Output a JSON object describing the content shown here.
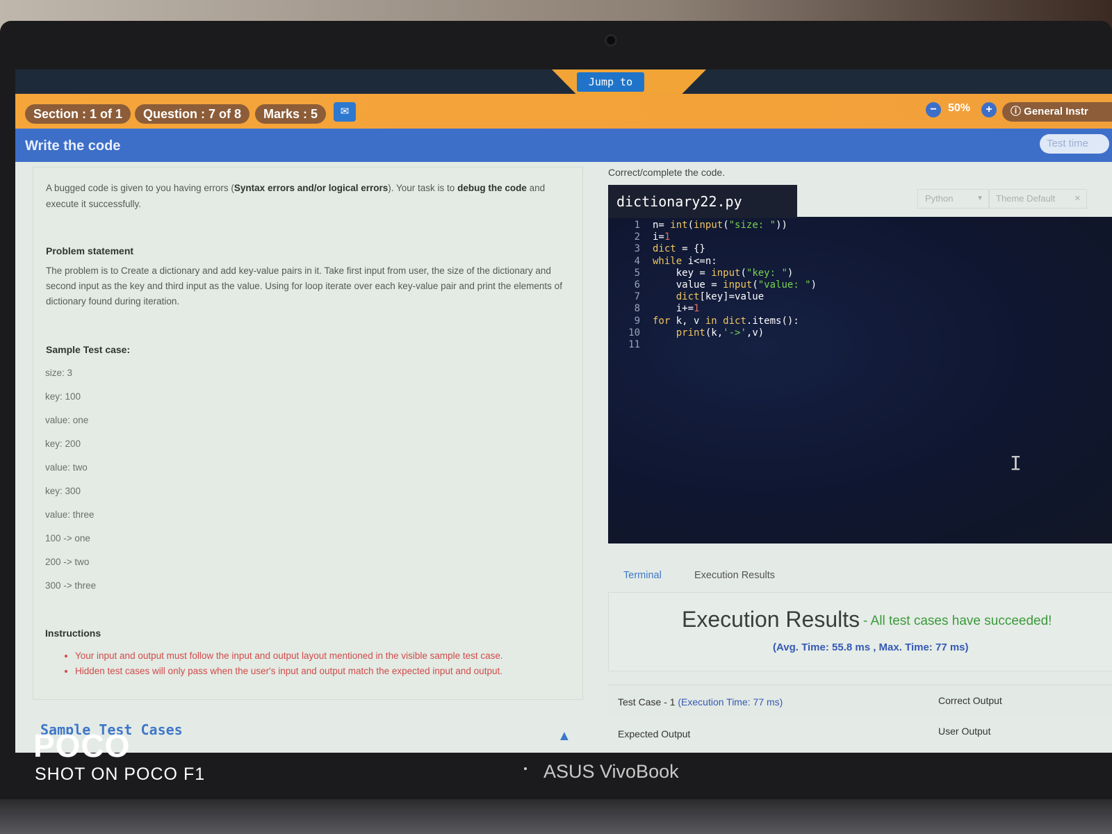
{
  "header": {
    "jump_to": "Jump to",
    "section": "Section : 1 of 1",
    "question": "Question : 7 of 8",
    "marks": "Marks : 5",
    "zoom_level": "50%",
    "general_instructions": "General Instr",
    "page_title": "Write the code",
    "test_timer": "Test time"
  },
  "problem": {
    "intro_part1": "A bugged code is given to you having errors (",
    "intro_bold1": "Syntax errors and/or logical errors",
    "intro_part2": "). Your task is to ",
    "intro_bold2": "debug the code",
    "intro_part3": " and execute it successfully.",
    "statement_heading": "Problem statement",
    "statement_text": "The problem is to Create a dictionary and add key-value pairs in it. Take first input from user, the size of the dictionary and second input as the key and third input as the value. Using for loop iterate over each key-value pair and print the elements of dictionary found during iteration.",
    "sample_heading": "Sample Test case:",
    "sample_lines": [
      "size: 3",
      "key: 100",
      "value: one",
      "key: 200",
      "value: two",
      "key: 300",
      "value: three",
      "100 -> one",
      "200 -> two",
      "300 -> three"
    ],
    "instructions_heading": "Instructions",
    "instructions": [
      "Your input and output must follow the input and output layout mentioned in the visible sample test case.",
      "Hidden test cases will only pass when the user's input and output match the expected input and output."
    ],
    "sample_test_cases_link": "Sample Test Cases"
  },
  "editor": {
    "heading": "Correct/complete the code.",
    "filename": "dictionary22.py",
    "language": "Python",
    "theme": "Theme Default",
    "code_lines": [
      "n= int(input(\"size: \"))",
      "i=1",
      "dict = {}",
      "while i<=n:",
      "    key = input(\"key: \")",
      "    value = input(\"value: \")",
      "    dict[key]=value",
      "    i+=1",
      "for k, v in dict.items():",
      "    print(k,'->',v)",
      ""
    ]
  },
  "results": {
    "tab_terminal": "Terminal",
    "tab_execution": "Execution Results",
    "title": "Execution Results",
    "message": "- All test cases have succeeded!",
    "times": "(Avg. Time: 55.8 ms , Max. Time: 77 ms)",
    "case_label": "Test Case - 1",
    "case_time": "(Execution Time: 77 ms)",
    "correct_output": "Correct Output",
    "expected_output": "Expected Output",
    "user_output": "User Output"
  },
  "device": {
    "photo_brand": "POCO",
    "photo_sub": "SHOT ON POCO F1",
    "laptop_brand": "ASUS VivoBook"
  },
  "colors": {
    "orange": "#f2a436",
    "blue": "#3d6fc9",
    "success": "#3a9a3b",
    "error_text": "#d24a4a"
  },
  "icons": [
    "chat-icon",
    "zoom-out-icon",
    "zoom-in-icon",
    "info-icon",
    "chevron-down-icon",
    "close-icon",
    "text-cursor-icon",
    "chevron-up-icon"
  ]
}
